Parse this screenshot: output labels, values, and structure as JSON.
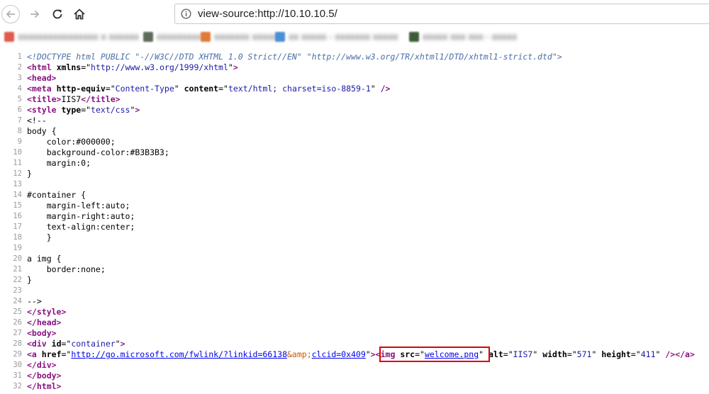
{
  "browser": {
    "url": "view-source:http://10.10.10.5/",
    "icons": {
      "back": "arrow-left-icon",
      "forward": "arrow-right-icon",
      "reload": "reload-icon",
      "home": "home-icon",
      "site_info": "info-icon"
    },
    "bookmarks": [
      {
        "label": "xxxxxxxxxxxxxxxx x xxxxxx",
        "color": "#e05a4e"
      },
      {
        "label": "xxxxxxxxx",
        "color": "#5f6b5a"
      },
      {
        "label": "xxxxxxx xxxxx",
        "color": "#e07a3a"
      },
      {
        "label": "xx xxxxx - xxxxxxx xxxxx",
        "color": "#4a8fd8"
      },
      {
        "label": "xxxxx xxx xxx - xxxxx",
        "color": "#3f5a3a"
      }
    ]
  },
  "source_lines": [
    {
      "n": "1",
      "segs": [
        {
          "c": "doctype",
          "t": "<!DOCTYPE html PUBLIC \"-//W3C//DTD XHTML 1.0 Strict//EN\" \"http://www.w3.org/TR/xhtml1/DTD/xhtml1-strict.dtd\">"
        }
      ]
    },
    {
      "n": "2",
      "segs": [
        {
          "c": "tag",
          "t": "<html"
        },
        {
          "c": "plain",
          "t": " "
        },
        {
          "c": "attr",
          "t": "xmlns"
        },
        {
          "c": "plain",
          "t": "=\""
        },
        {
          "c": "val",
          "t": "http://www.w3.org/1999/xhtml"
        },
        {
          "c": "plain",
          "t": "\""
        },
        {
          "c": "tag",
          "t": ">"
        }
      ]
    },
    {
      "n": "3",
      "segs": [
        {
          "c": "tag",
          "t": "<head>"
        }
      ]
    },
    {
      "n": "4",
      "segs": [
        {
          "c": "tag",
          "t": "<meta"
        },
        {
          "c": "plain",
          "t": " "
        },
        {
          "c": "attr",
          "t": "http-equiv"
        },
        {
          "c": "plain",
          "t": "=\""
        },
        {
          "c": "val",
          "t": "Content-Type"
        },
        {
          "c": "plain",
          "t": "\" "
        },
        {
          "c": "attr",
          "t": "content"
        },
        {
          "c": "plain",
          "t": "=\""
        },
        {
          "c": "val",
          "t": "text/html; charset=iso-8859-1"
        },
        {
          "c": "plain",
          "t": "\" "
        },
        {
          "c": "tag",
          "t": "/>"
        }
      ]
    },
    {
      "n": "5",
      "segs": [
        {
          "c": "tag",
          "t": "<title>"
        },
        {
          "c": "plain",
          "t": "IIS7"
        },
        {
          "c": "tag",
          "t": "</title>"
        }
      ]
    },
    {
      "n": "6",
      "segs": [
        {
          "c": "tag",
          "t": "<style"
        },
        {
          "c": "plain",
          "t": " "
        },
        {
          "c": "attr",
          "t": "type"
        },
        {
          "c": "plain",
          "t": "=\""
        },
        {
          "c": "val",
          "t": "text/css"
        },
        {
          "c": "plain",
          "t": "\""
        },
        {
          "c": "tag",
          "t": ">"
        }
      ]
    },
    {
      "n": "7",
      "segs": [
        {
          "c": "plain",
          "t": "<!--"
        }
      ]
    },
    {
      "n": "8",
      "segs": [
        {
          "c": "plain",
          "t": "body {"
        }
      ]
    },
    {
      "n": "9",
      "segs": [
        {
          "c": "plain",
          "t": "    color:#000000;"
        }
      ]
    },
    {
      "n": "10",
      "segs": [
        {
          "c": "plain",
          "t": "    background-color:#B3B3B3;"
        }
      ]
    },
    {
      "n": "11",
      "segs": [
        {
          "c": "plain",
          "t": "    margin:0;"
        }
      ]
    },
    {
      "n": "12",
      "segs": [
        {
          "c": "plain",
          "t": "}"
        }
      ]
    },
    {
      "n": "13",
      "segs": [
        {
          "c": "plain",
          "t": ""
        }
      ]
    },
    {
      "n": "14",
      "segs": [
        {
          "c": "plain",
          "t": "#container {"
        }
      ]
    },
    {
      "n": "15",
      "segs": [
        {
          "c": "plain",
          "t": "    margin-left:auto;"
        }
      ]
    },
    {
      "n": "16",
      "segs": [
        {
          "c": "plain",
          "t": "    margin-right:auto;"
        }
      ]
    },
    {
      "n": "17",
      "segs": [
        {
          "c": "plain",
          "t": "    text-align:center;"
        }
      ]
    },
    {
      "n": "18",
      "segs": [
        {
          "c": "plain",
          "t": "    }"
        }
      ]
    },
    {
      "n": "19",
      "segs": [
        {
          "c": "plain",
          "t": ""
        }
      ]
    },
    {
      "n": "20",
      "segs": [
        {
          "c": "plain",
          "t": "a img {"
        }
      ]
    },
    {
      "n": "21",
      "segs": [
        {
          "c": "plain",
          "t": "    border:none;"
        }
      ]
    },
    {
      "n": "22",
      "segs": [
        {
          "c": "plain",
          "t": "}"
        }
      ]
    },
    {
      "n": "23",
      "segs": [
        {
          "c": "plain",
          "t": ""
        }
      ]
    },
    {
      "n": "24",
      "segs": [
        {
          "c": "plain",
          "t": "-->"
        }
      ]
    },
    {
      "n": "25",
      "segs": [
        {
          "c": "tag",
          "t": "</style>"
        }
      ]
    },
    {
      "n": "26",
      "segs": [
        {
          "c": "tag",
          "t": "</head>"
        }
      ]
    },
    {
      "n": "27",
      "segs": [
        {
          "c": "tag",
          "t": "<body>"
        }
      ]
    },
    {
      "n": "28",
      "segs": [
        {
          "c": "tag",
          "t": "<div"
        },
        {
          "c": "plain",
          "t": " "
        },
        {
          "c": "attr",
          "t": "id"
        },
        {
          "c": "plain",
          "t": "=\""
        },
        {
          "c": "val",
          "t": "container"
        },
        {
          "c": "plain",
          "t": "\""
        },
        {
          "c": "tag",
          "t": ">"
        }
      ]
    },
    {
      "n": "29",
      "segs": [
        {
          "c": "tag",
          "t": "<a"
        },
        {
          "c": "plain",
          "t": " "
        },
        {
          "c": "attr",
          "t": "href"
        },
        {
          "c": "plain",
          "t": "=\""
        },
        {
          "c": "link",
          "t": "http://go.microsoft.com/fwlink/?linkid=66138"
        },
        {
          "c": "ent",
          "t": "&amp;"
        },
        {
          "c": "link",
          "t": "clcid=0x409"
        },
        {
          "c": "plain",
          "t": "\""
        },
        {
          "c": "tag",
          "t": ">"
        },
        {
          "c": "tag",
          "t": "<img"
        },
        {
          "c": "plain",
          "t": " "
        },
        {
          "c": "attr",
          "t": "src"
        },
        {
          "c": "plain",
          "t": "=\""
        },
        {
          "c": "link",
          "t": "welcome.png"
        },
        {
          "c": "plain",
          "t": "\" "
        },
        {
          "c": "attr",
          "t": "alt"
        },
        {
          "c": "plain",
          "t": "=\""
        },
        {
          "c": "val",
          "t": "IIS7"
        },
        {
          "c": "plain",
          "t": "\" "
        },
        {
          "c": "attr",
          "t": "width"
        },
        {
          "c": "plain",
          "t": "=\""
        },
        {
          "c": "val",
          "t": "571"
        },
        {
          "c": "plain",
          "t": "\" "
        },
        {
          "c": "attr",
          "t": "height"
        },
        {
          "c": "plain",
          "t": "=\""
        },
        {
          "c": "val",
          "t": "411"
        },
        {
          "c": "plain",
          "t": "\" "
        },
        {
          "c": "tag",
          "t": "/></a>"
        }
      ]
    },
    {
      "n": "30",
      "segs": [
        {
          "c": "tag",
          "t": "</div>"
        }
      ]
    },
    {
      "n": "31",
      "segs": [
        {
          "c": "tag",
          "t": "</body>"
        }
      ]
    },
    {
      "n": "32",
      "segs": [
        {
          "c": "tag",
          "t": "</html>"
        }
      ]
    }
  ],
  "highlight": {
    "color": "#e00000",
    "target_line": "29",
    "target_text": "<img src=\"welcome.png\""
  }
}
